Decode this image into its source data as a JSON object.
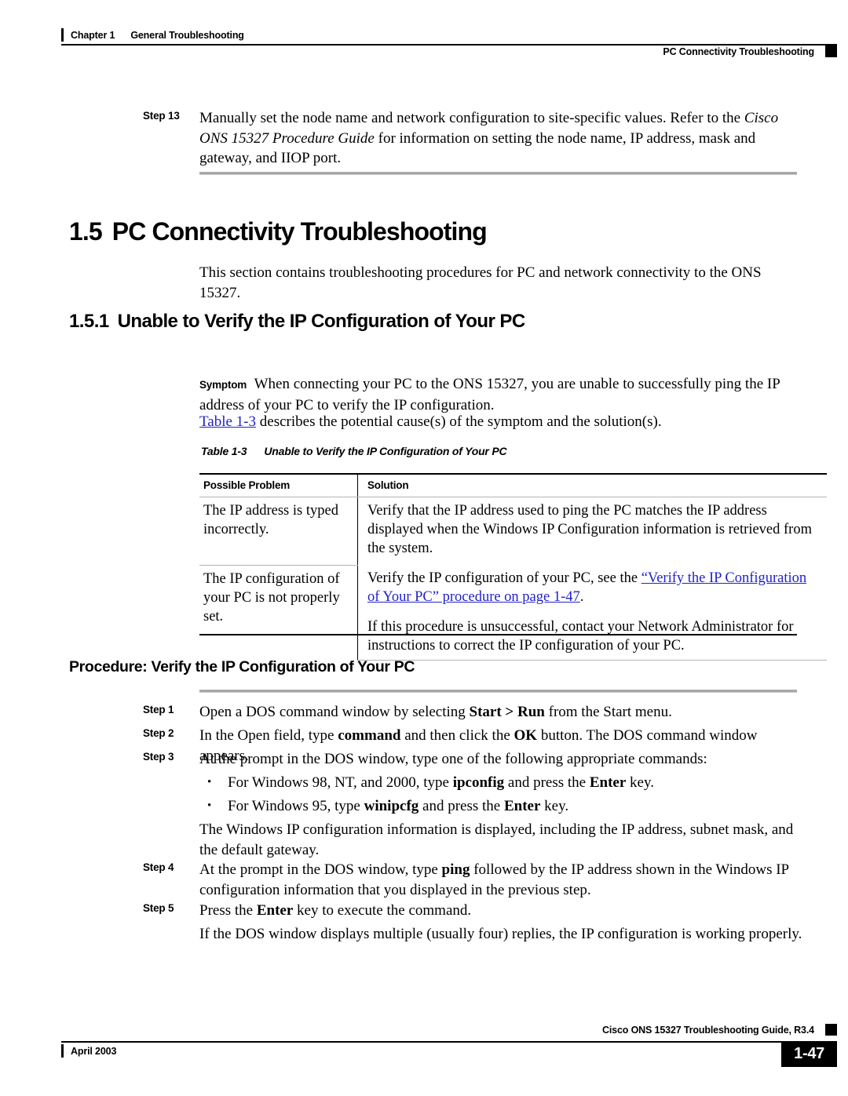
{
  "header": {
    "chapter": "Chapter 1",
    "chapter_title": "General Troubleshooting",
    "section": "PC Connectivity Troubleshooting"
  },
  "step13": {
    "label": "Step 13",
    "text_part1": "Manually set the node name and network configuration to site-specific values. Refer to the ",
    "italic_title": "Cisco ONS 15327 Procedure Guide",
    "text_part2": " for information on setting the node name, IP address, mask and gateway, and IIOP port."
  },
  "section": {
    "number": "1.5",
    "title": "PC Connectivity Troubleshooting",
    "intro": "This section contains troubleshooting procedures for PC and network connectivity to the ONS 15327."
  },
  "subsection": {
    "number": "1.5.1",
    "title": "Unable to Verify the IP Configuration of Your PC"
  },
  "symptom": {
    "label": "Symptom",
    "text": "When connecting your PC to the ONS 15327, you are unable to successfully ping the IP address of your PC to verify the IP configuration."
  },
  "table_intro": {
    "link": "Table 1-3",
    "text": " describes the potential cause(s) of the symptom and the solution(s)."
  },
  "table": {
    "caption_number": "Table 1-3",
    "caption_title": "Unable to Verify the IP Configuration of Your PC",
    "columns": [
      "Possible Problem",
      "Solution"
    ],
    "rows": [
      {
        "problem": "The IP address is typed incorrectly.",
        "solution": "Verify that the IP address used to ping the PC matches the IP address displayed when the Windows IP Configuration information is retrieved from the system."
      },
      {
        "problem": "The IP configuration of your PC is not properly set.",
        "solution_p1_before": "Verify the IP configuration of your PC, see the ",
        "solution_p1_link": "“Verify the IP Configuration of Your PC” procedure on page 1-47",
        "solution_p1_after": ".",
        "solution_p2": "If this procedure is unsuccessful, contact your Network Administrator for instructions to correct the IP configuration of your PC."
      }
    ]
  },
  "procedure": {
    "title": "Procedure: Verify the IP Configuration of Your PC",
    "steps": [
      {
        "label": "Step 1",
        "pre": "Open a DOS command window by selecting ",
        "bold": "Start > Run",
        "post": " from the Start menu."
      },
      {
        "label": "Step 2",
        "pre": "In the Open field, type ",
        "bold": "command",
        "mid": " and then click the ",
        "bold2": "OK",
        "post": " button. The DOS command window appears."
      },
      {
        "label": "Step 3",
        "pre": "At the prompt in the DOS window, type one of the following appropriate commands:"
      },
      {
        "label": "Step 4",
        "pre": "At the prompt in the DOS window, type ",
        "bold": "ping",
        "post": " followed by the IP address shown in the Windows IP configuration information that you displayed in the previous step."
      },
      {
        "label": "Step 5",
        "pre": "Press the ",
        "bold": "Enter",
        "post": " key to execute the command."
      }
    ],
    "bullets": [
      {
        "marker": "•",
        "pre": "For Windows 98, NT, and 2000, type ",
        "bold": "ipconfig",
        "mid": " and press the ",
        "bold2": "Enter",
        "post": " key."
      },
      {
        "marker": "•",
        "pre": "For Windows 95, type ",
        "bold": "winipcfg",
        "mid": " and press the ",
        "bold2": "Enter",
        "post": " key."
      }
    ],
    "after_bullets": "The Windows IP configuration information is displayed, including the IP address, subnet mask, and the default gateway.",
    "after_step5": "If the DOS window displays multiple (usually four) replies, the IP configuration is working properly."
  },
  "footer": {
    "guide": "Cisco ONS 15327 Troubleshooting Guide, R3.4",
    "date": "April 2003",
    "page_number": "1-47"
  },
  "colors": {
    "link": "#2222cc",
    "rule": "#9a9a9a",
    "tab": "#000000"
  }
}
